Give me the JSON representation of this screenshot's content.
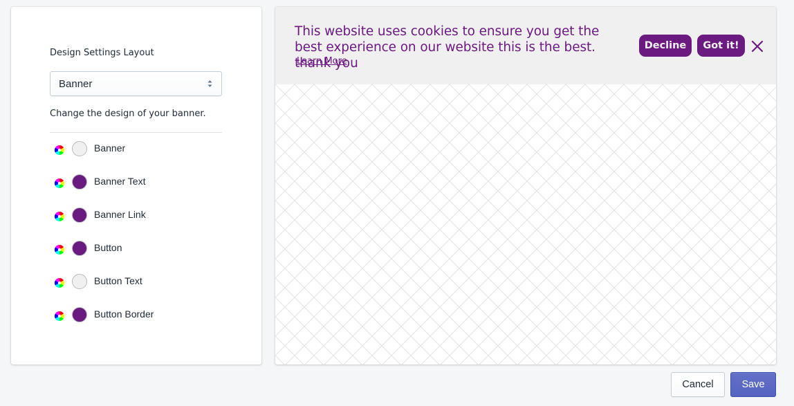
{
  "settings": {
    "layout_label": "Design Settings Layout",
    "layout_value": "Banner",
    "help_text": "Change the design of your banner.",
    "color_rows": [
      {
        "label": "Banner",
        "color": "#f0f0f0"
      },
      {
        "label": "Banner Text",
        "color": "#6b1a80"
      },
      {
        "label": "Banner Link",
        "color": "#6b1a80"
      },
      {
        "label": "Button",
        "color": "#6b1a80"
      },
      {
        "label": "Button Text",
        "color": "#f0f0f0"
      },
      {
        "label": "Button Border",
        "color": "#6b1a80"
      }
    ]
  },
  "preview": {
    "message": "This website uses cookies to ensure you get the best experience on our website this is the best. thank you",
    "learn_more": "Learn More",
    "decline_label": "Decline",
    "got_it_label": "Got it!",
    "close_icon": "close-icon",
    "colors": {
      "banner_bg": "#f0f0f0",
      "text": "#6b1a80",
      "link": "#6b1a80",
      "button_bg": "#6b1a80",
      "button_text": "#f0f0f0",
      "button_border": "#6b1a80"
    }
  },
  "actions": {
    "cancel_label": "Cancel",
    "save_label": "Save"
  }
}
